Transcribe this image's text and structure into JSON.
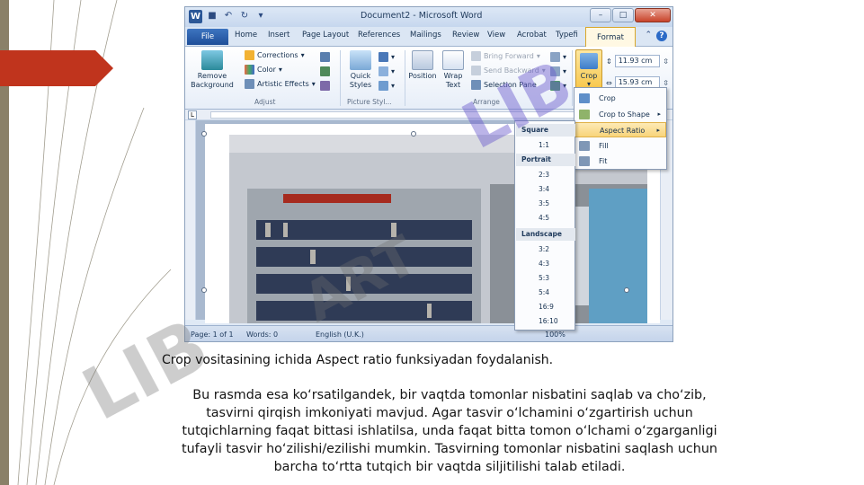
{
  "colors": {
    "accent_red": "#c0341d",
    "ribbon_blue": "#2b5797",
    "selected_gold": "#f8c545",
    "watermark_purple": "#6a5acd",
    "watermark_gray": "#8a8a8a"
  },
  "window": {
    "title": "Document2 - Microsoft Word",
    "app_icon": "W",
    "quick_access": [
      "save-icon",
      "undo-icon",
      "redo-icon"
    ],
    "controls": {
      "minimize": "–",
      "maximize": "□",
      "close": "✕"
    }
  },
  "tabs": {
    "file": "File",
    "items": [
      "Home",
      "Insert",
      "Page Layout",
      "References",
      "Mailings",
      "Review",
      "View",
      "Acrobat",
      "Typefi"
    ],
    "active": "Format"
  },
  "ribbon": {
    "adjust": {
      "remove_background": "Remove Background",
      "corrections": "Corrections",
      "color": "Color",
      "artistic_effects": "Artistic Effects",
      "label": "Adjust"
    },
    "picture_styles": {
      "quick_styles": "Quick Styles",
      "label": "Picture Styl..."
    },
    "arrange": {
      "position": "Position",
      "wrap_text": "Wrap Text",
      "bring_forward": "Bring Forward",
      "send_backward": "Send Backward",
      "selection_pane": "Selection Pane",
      "label": "Arrange"
    },
    "size": {
      "crop": "Crop",
      "height": "11.93 cm",
      "width": "15.93 cm"
    }
  },
  "crop_menu": {
    "items": [
      "Crop",
      "Crop to Shape",
      "Aspect Ratio",
      "Fill",
      "Fit"
    ]
  },
  "aspect_menu": {
    "square_header": "Square",
    "square": [
      "1:1"
    ],
    "portrait_header": "Portrait",
    "portrait": [
      "2:3",
      "3:4",
      "3:5",
      "4:5"
    ],
    "landscape_header": "Landscape",
    "landscape": [
      "3:2",
      "4:3",
      "5:3",
      "5:4",
      "16:9",
      "16:10"
    ]
  },
  "status": {
    "page": "Page: 1 of 1",
    "words": "Words: 0",
    "language": "English (U.K.)",
    "zoom": "100%"
  },
  "caption": "Crop vositasining ichida Aspect ratio funksiyadan foydalanish.",
  "body_lines": [
    "Bu rasmda esa ko‘rsatilgandek, bir vaqtda tomonlar nisbatini saqlab va cho‘zib,",
    "tasvirni qirqish imkoniyati mavjud. Agar tasvir o‘lchamini o‘zgartirish uchun",
    "tutqichlarning faqat bittasi ishlatilsa, unda faqat bitta tomon o‘lchami o‘zgarganligi",
    "tufayli tasvir ho‘zilishi/ezilishi mumkin. Tasvirning tomonlar nisbatini saqlash uchun",
    "barcha to‘rtta tutqich bir vaqtda siljitilishi talab etiladi."
  ]
}
